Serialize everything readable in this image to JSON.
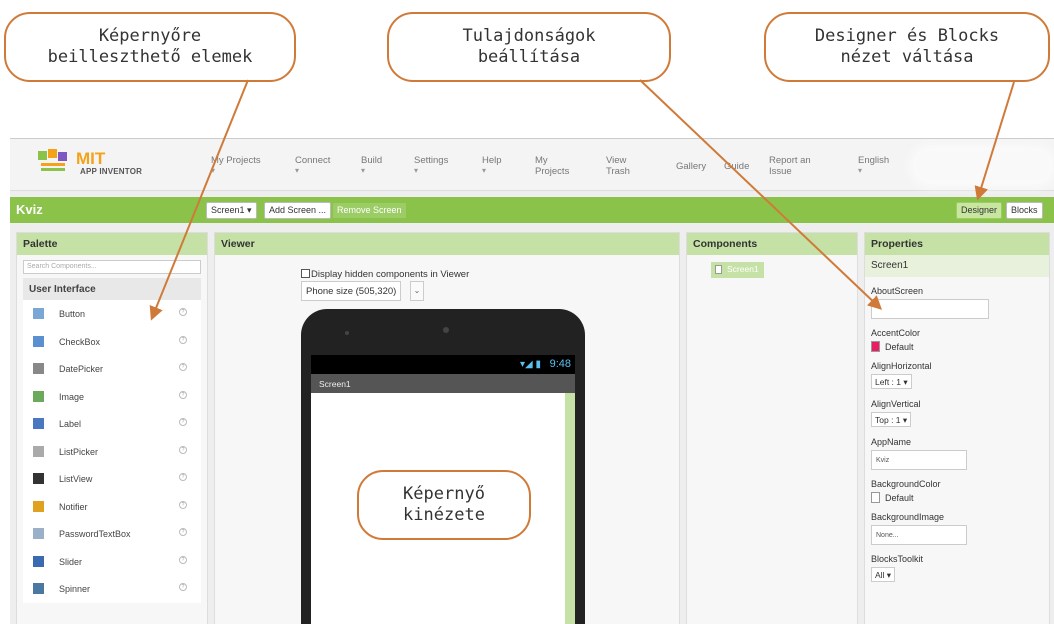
{
  "callouts": {
    "palette": [
      "Képernyőre",
      "beilleszthető elemek"
    ],
    "properties": [
      "Tulajdonságok",
      "beállítása"
    ],
    "switch": [
      "Designer és Blocks",
      "nézet váltása"
    ],
    "phone": [
      "Képernyő",
      "kinézete"
    ]
  },
  "callout_color": "#d07a3a",
  "logo": {
    "brand": "MIT",
    "sub": "APP INVENTOR"
  },
  "menu": [
    {
      "label": "My Projects",
      "dropdown": true
    },
    {
      "label": "Connect",
      "dropdown": true
    },
    {
      "label": "Build",
      "dropdown": true
    },
    {
      "label": "Settings",
      "dropdown": true
    },
    {
      "label": "Help",
      "dropdown": true
    },
    {
      "label": "My Projects",
      "dropdown": false
    },
    {
      "label": "View Trash",
      "dropdown": false
    },
    {
      "label": "Gallery",
      "dropdown": false
    },
    {
      "label": "Guide",
      "dropdown": false
    },
    {
      "label": "Report an Issue",
      "dropdown": false
    },
    {
      "label": "English",
      "dropdown": true
    }
  ],
  "menu_dropdown_glyph": "▾",
  "toolbar": {
    "project_name": "Kviz",
    "screen_select": "Screen1 ▾",
    "add_screen": "Add Screen ...",
    "remove_screen": "Remove Screen",
    "designer": "Designer",
    "blocks": "Blocks"
  },
  "accent_green": "#8bc34a",
  "palette": {
    "header": "Palette",
    "search_placeholder": "Search Components...",
    "category": "User Interface",
    "help_glyph": "?",
    "items": [
      {
        "label": "Button",
        "icon": "button-icon",
        "color": "#7aa7d6"
      },
      {
        "label": "CheckBox",
        "icon": "checkbox-icon",
        "color": "#5a8fd0"
      },
      {
        "label": "DatePicker",
        "icon": "datepicker-icon",
        "color": "#888888"
      },
      {
        "label": "Image",
        "icon": "image-icon",
        "color": "#6aaa5a"
      },
      {
        "label": "Label",
        "icon": "label-icon",
        "color": "#4a78c0"
      },
      {
        "label": "ListPicker",
        "icon": "listpicker-icon",
        "color": "#aaaaaa"
      },
      {
        "label": "ListView",
        "icon": "listview-icon",
        "color": "#333333"
      },
      {
        "label": "Notifier",
        "icon": "notifier-icon",
        "color": "#e0a020"
      },
      {
        "label": "PasswordTextBox",
        "icon": "passwordtextbox-icon",
        "color": "#9ab0c8"
      },
      {
        "label": "Slider",
        "icon": "slider-icon",
        "color": "#3a6ab0"
      },
      {
        "label": "Spinner",
        "icon": "spinner-icon",
        "color": "#4a78a0"
      }
    ]
  },
  "viewer": {
    "header": "Viewer",
    "hidden_checkbox_label": "Display hidden components in Viewer",
    "size_select": "Phone size (505,320)",
    "size_arrow": "⌄",
    "phone_time": "9:48",
    "phone_signal": "▾◢ ▮",
    "phone_screen_title": "Screen1"
  },
  "components": {
    "header": "Components",
    "items": [
      "Screen1"
    ]
  },
  "properties": {
    "header": "Properties",
    "selected": "Screen1",
    "about_label": "AboutScreen",
    "accent_label": "AccentColor",
    "accent_value": "Default",
    "accent_color": "#e91e63",
    "align_h_label": "AlignHorizontal",
    "align_h_value": "Left : 1 ▾",
    "align_v_label": "AlignVertical",
    "align_v_value": "Top : 1 ▾",
    "appname_label": "AppName",
    "appname_value": "Kviz",
    "bgcolor_label": "BackgroundColor",
    "bgcolor_value": "Default",
    "bgcolor_color": "#ffffff",
    "bgimage_label": "BackgroundImage",
    "bgimage_value": "None...",
    "toolkit_label": "BlocksToolkit",
    "toolkit_value": "All ▾"
  }
}
